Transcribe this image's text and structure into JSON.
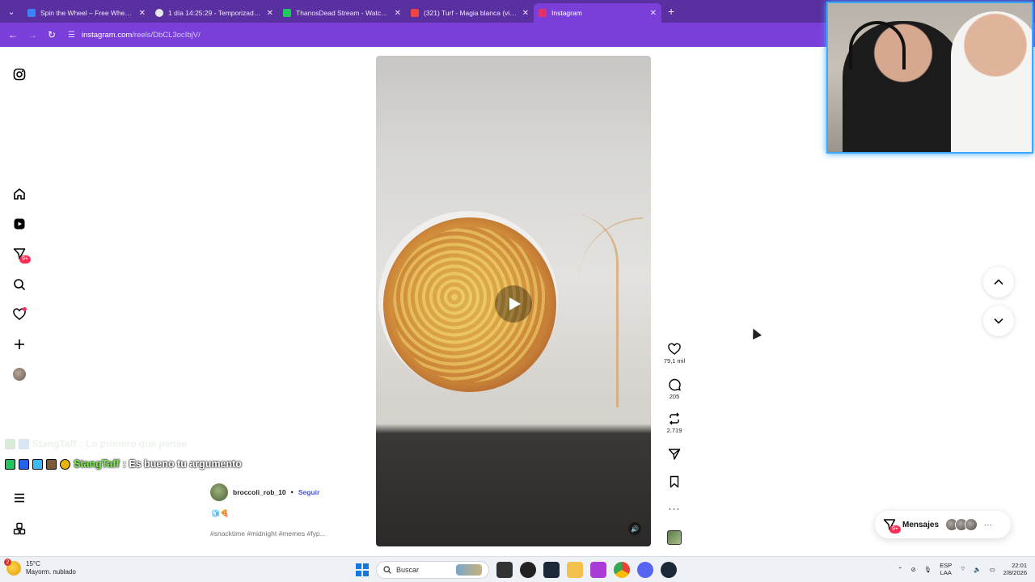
{
  "browser": {
    "tabs": [
      {
        "title": "Spin the Wheel – Free Wheel Sp",
        "color": "#3b82f6",
        "active": false
      },
      {
        "title": "1 día 14:25:29 - Temporizador C",
        "color": "#e5e7eb",
        "active": false
      },
      {
        "title": "ThanosDead Stream - Watch Li",
        "color": "#22c55e",
        "active": false
      },
      {
        "title": "(321) Turf - Magia blanca (vide",
        "color": "#ef4444",
        "active": false
      },
      {
        "title": "Instagram",
        "color": "#e1306c",
        "active": true
      }
    ],
    "new_tab": "+",
    "address": {
      "host": "instagram.com",
      "path": "/reels/DbCL3ocIbjV/"
    }
  },
  "sidebar": {
    "notifications_badge": "9+"
  },
  "reel": {
    "likes": "79,1 mil",
    "comments": "205",
    "reposts": "2.719",
    "author": "broccoli_rob_10",
    "separator": "•",
    "follow_label": "Seguir",
    "caption": "🧊🍕",
    "tags": "#snacktime #midnight #memes #fyp..."
  },
  "chat": {
    "faded_name": "StangTaff",
    "faded_msg": ": Lo primero que pense",
    "name": "StangTaff",
    "message": ": Es bueno tu argumento"
  },
  "messages": {
    "label": "Mensajes",
    "badge": "9+",
    "more": "···"
  },
  "taskbar": {
    "temperature": "15°C",
    "weather": "Mayorm. nublado",
    "weather_badge": "2",
    "search_placeholder": "Buscar",
    "lang_top": "ESP",
    "lang_bottom": "LAA",
    "time": "22:01",
    "date": "2/8/2026"
  },
  "colors": {
    "browser_tabbar": "#5a2fa0",
    "browser_toolbar": "#7a3fd8",
    "follow_link": "#4150f7",
    "chat_name": "#7cf04a",
    "notification": "#ff2d55"
  }
}
